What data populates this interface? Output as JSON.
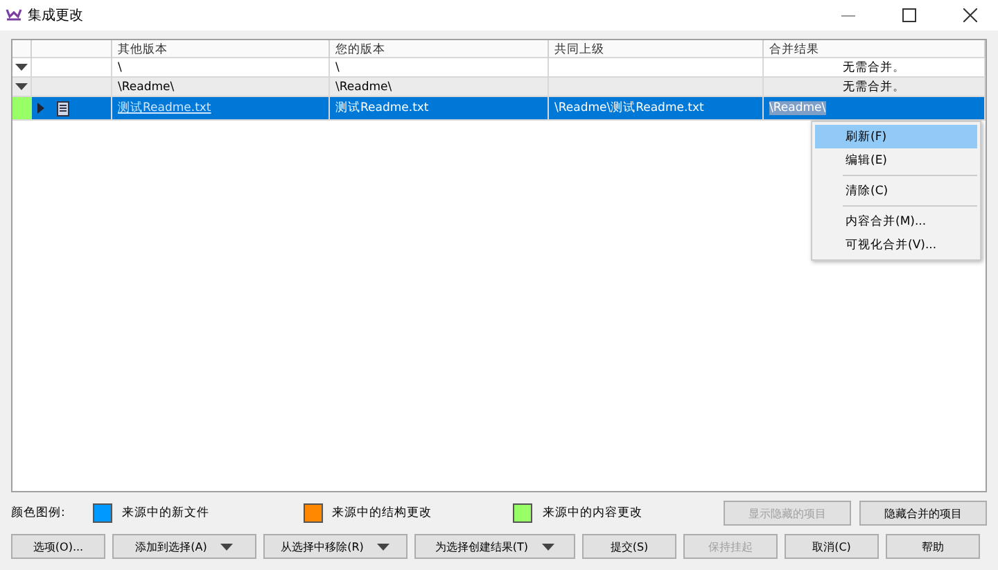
{
  "window": {
    "title": "集成更改"
  },
  "table": {
    "columns": [
      "其他版本",
      "您的版本",
      "共同上级",
      "合并结果"
    ],
    "rows": [
      {
        "kind": "folder",
        "expanded": true,
        "selected": false,
        "other": "\\",
        "yours": "\\",
        "ancestor": "",
        "result": "无需合并。"
      },
      {
        "kind": "folder",
        "expanded": true,
        "selected": false,
        "other": "\\Readme\\",
        "yours": "\\Readme\\",
        "ancestor": "",
        "result": "无需合并。"
      },
      {
        "kind": "file",
        "expanded": false,
        "selected": true,
        "color": "#99ff66",
        "other": "测试Readme.txt",
        "yours": "测试Readme.txt",
        "ancestor": "\\Readme\\测试Readme.txt",
        "result": "\\Readme\\"
      }
    ]
  },
  "context_menu": [
    {
      "label": "刷新(F)",
      "selected": true
    },
    {
      "label": "编辑(E)",
      "selected": false
    },
    {
      "label": "清除(C)",
      "selected": false,
      "separator_before": true
    },
    {
      "label": "内容合并(M)...",
      "selected": false,
      "separator_before": true
    },
    {
      "label": "可视化合并(V)...",
      "selected": false
    }
  ],
  "legend": {
    "label": "颜色图例:",
    "items": [
      {
        "label": "来源中的新文件",
        "color": "#0099ff"
      },
      {
        "label": "来源中的结构更改",
        "color": "#ff8800"
      },
      {
        "label": "来源中的内容更改",
        "color": "#99ff66"
      }
    ]
  },
  "side_buttons": [
    {
      "label": "显示隐藏的项目",
      "disabled": true
    },
    {
      "label": "隐藏合并的项目",
      "disabled": false
    }
  ],
  "buttons": [
    {
      "label": "选项(O)...",
      "dropdown": false,
      "disabled": false
    },
    {
      "label": "添加到选择(A)",
      "dropdown": true,
      "disabled": false
    },
    {
      "label": "从选择中移除(R)",
      "dropdown": true,
      "disabled": false
    },
    {
      "label": "为选择创建结果(T)",
      "dropdown": true,
      "disabled": false
    },
    {
      "label": "提交(S)",
      "dropdown": false,
      "disabled": false
    },
    {
      "label": "保持挂起",
      "dropdown": false,
      "disabled": true
    },
    {
      "label": "取消(C)",
      "dropdown": false,
      "disabled": false
    },
    {
      "label": "帮助",
      "dropdown": false,
      "disabled": false
    }
  ]
}
